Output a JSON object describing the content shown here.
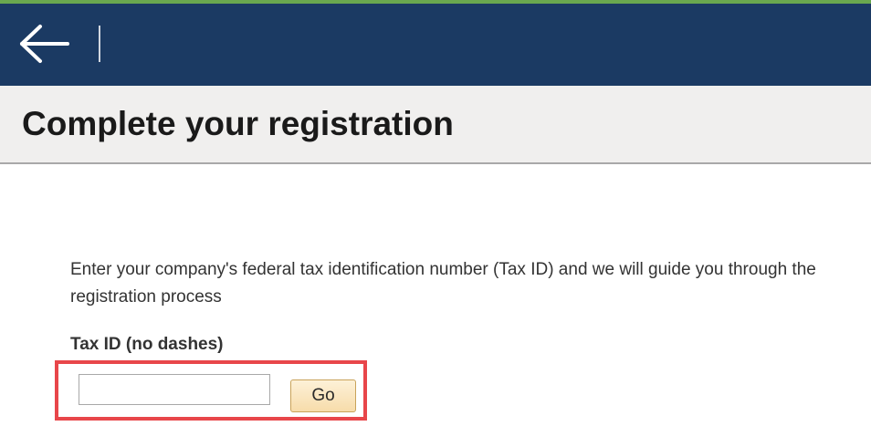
{
  "header": {
    "back_icon": "arrow-left-icon"
  },
  "page": {
    "title": "Complete your registration"
  },
  "form": {
    "intro": "Enter your company's federal tax identification number (Tax ID) and we will guide you through the registration process",
    "tax_id_label": "Tax ID (no dashes)",
    "tax_id_value": "",
    "go_label": "Go"
  },
  "colors": {
    "header_bg": "#1b3a63",
    "accent_strip": "#6aa84f",
    "title_band_bg": "#f0efee",
    "highlight_border": "#e8464a",
    "go_button_bg": "#f7dcaa"
  }
}
